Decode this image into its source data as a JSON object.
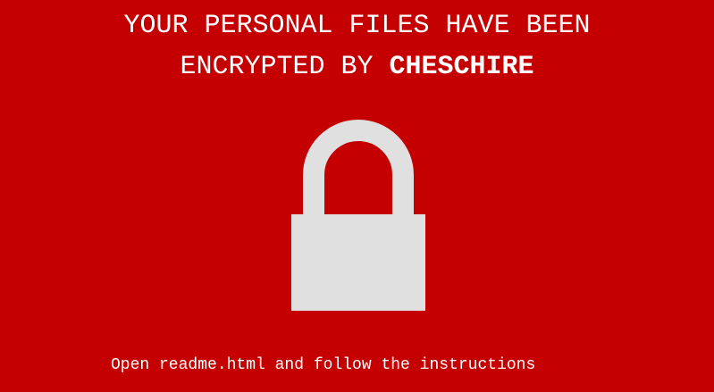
{
  "headline": {
    "line1": "YOUR PERSONAL FILES HAVE BEEN",
    "line2_prefix": "ENCRYPTED BY ",
    "brand": "CHESCHIRE"
  },
  "icon": "padlock-icon",
  "footer": {
    "instructions": "Open readme.html and follow the instructions"
  },
  "colors": {
    "background": "#c40000",
    "text": "#ffffff",
    "lock": "#e0e0e0"
  }
}
